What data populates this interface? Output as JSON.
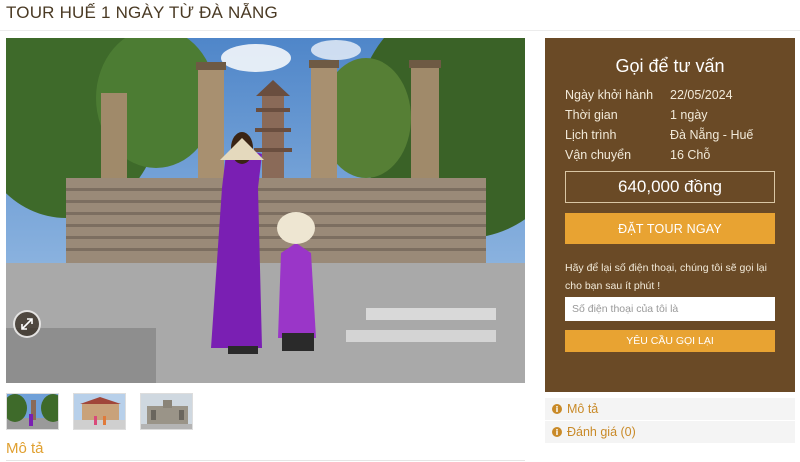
{
  "page": {
    "title": "TOUR HUẾ 1 NGÀY TỪ ĐÀ NẴNG"
  },
  "gallery": {
    "zoom_icon": "expand-icon",
    "thumbnail_count": 3
  },
  "description": {
    "heading": "Mô tả"
  },
  "consult": {
    "title": "Gọi để tư vấn",
    "rows": [
      {
        "label": "Ngày khởi hành",
        "value": "22/05/2024"
      },
      {
        "label": "Thời gian",
        "value": "1 ngày"
      },
      {
        "label": "Lịch trình",
        "value": "Đà Nẵng - Huế"
      },
      {
        "label": "Vận chuyển",
        "value": "16 Chỗ"
      }
    ],
    "price": "640,000 đồng",
    "book_label": "ĐẶT TOUR NGAY",
    "leave_text": "Hãy để lại số điện thoại, chúng tôi sẽ gọi lại cho bạn sau ít phút !",
    "phone_placeholder": "Số điện thoại của tôi là",
    "callback_label": "YÊU CẦU GỌI LẠI"
  },
  "accordion": [
    {
      "label": "Mô tả",
      "icon": "info-icon"
    },
    {
      "label": "Đánh giá (0)",
      "icon": "info-icon"
    }
  ],
  "colors": {
    "panel_bg": "#6a4a26",
    "accent": "#e8a332",
    "link": "#c98a28"
  }
}
